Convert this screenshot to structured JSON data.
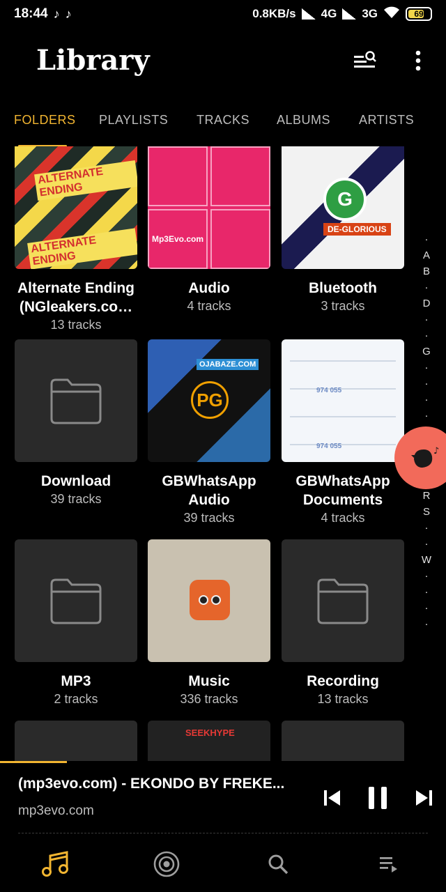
{
  "status_bar": {
    "time": "18:44",
    "speed": "0.8KB/s",
    "net1": "4G",
    "net2": "3G",
    "battery": "69"
  },
  "header": {
    "title": "Library"
  },
  "tabs": [
    {
      "label": "FOLDERS",
      "active": true
    },
    {
      "label": "PLAYLISTS",
      "active": false
    },
    {
      "label": "TRACKS",
      "active": false
    },
    {
      "label": "ALBUMS",
      "active": false
    },
    {
      "label": "ARTISTS",
      "active": false
    }
  ],
  "folders": [
    {
      "name": "Alternate Ending (NGleakers.co…",
      "count": "13 tracks"
    },
    {
      "name": "Audio",
      "count": "4 tracks"
    },
    {
      "name": "Bluetooth",
      "count": "3 tracks"
    },
    {
      "name": "Download",
      "count": "39 tracks"
    },
    {
      "name": "GBWhatsApp Audio",
      "count": "39 tracks"
    },
    {
      "name": "GBWhatsApp Documents",
      "count": "4 tracks"
    },
    {
      "name": "MP3",
      "count": "2 tracks"
    },
    {
      "name": "Music",
      "count": "336 tracks"
    },
    {
      "name": "Recording",
      "count": "13 tracks"
    }
  ],
  "artwork_text": {
    "alt1": "ALTERNATE ENDING",
    "alt2": "ALTERNATE ENDING",
    "mp3evo": "Mp3Evo.com",
    "deglorious": "DE-GLORIOUS",
    "ojabaze": "OJABAZE.COM",
    "doc_num": "974 055",
    "seek": "SEEKHYPE"
  },
  "alphabet_index": [
    "·",
    "A",
    "B",
    "·",
    "D",
    "·",
    "·",
    "G",
    "·",
    "·",
    "·",
    "·",
    "·",
    "·",
    "·",
    "·",
    "R",
    "S",
    "·",
    "·",
    "W",
    "·",
    "·",
    "·",
    "·"
  ],
  "player": {
    "title": "(mp3evo.com) - EKONDO BY FREKE...",
    "artist": "mp3evo.com",
    "progress": 0.15
  },
  "colors": {
    "accent": "#f2b531",
    "bubble": "#f26a5a"
  }
}
